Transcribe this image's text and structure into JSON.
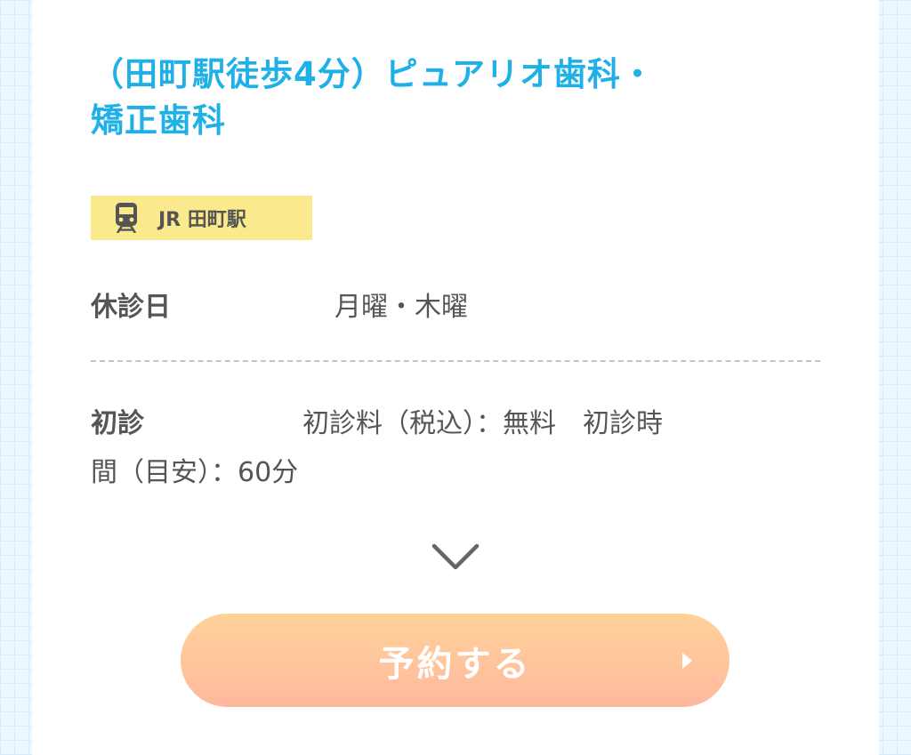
{
  "clinic": {
    "name_line1": "（田町駅徒歩4分）ピュアリオ歯科・",
    "name_line2": "矯正歯科"
  },
  "station": {
    "icon": "train-icon",
    "label": "JR 田町駅"
  },
  "closed_days": {
    "label": "休診日",
    "value": "月曜・木曜"
  },
  "first_visit": {
    "label": "初診",
    "value_line1": "初診料（税込）：無料　初診時",
    "value_line2": "間（目安）：60分"
  },
  "expand": {
    "icon": "chevron-down-icon"
  },
  "reserve_button": {
    "label": "予約する",
    "icon": "arrow-right-icon"
  },
  "colors": {
    "title": "#1fb0e8",
    "station_tag": "#fae98d",
    "button_top": "#ffd39a",
    "button_bottom": "#ffb89e",
    "text": "#555555"
  }
}
